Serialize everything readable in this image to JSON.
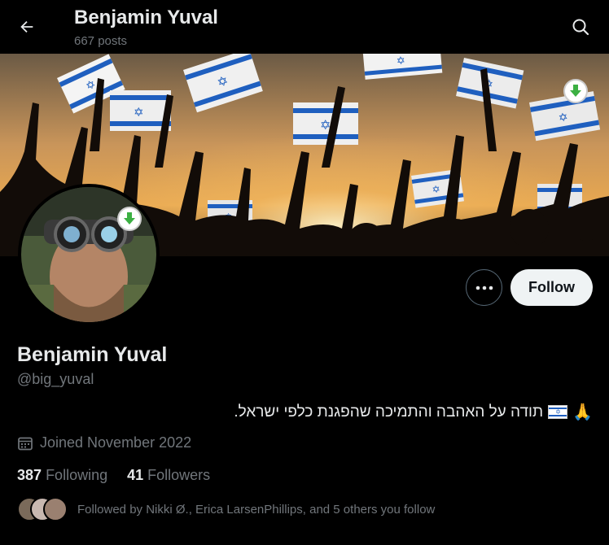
{
  "header": {
    "name": "Benjamin Yuval",
    "posts": "667 posts"
  },
  "icons": {
    "back": "arrow-left-icon",
    "search": "search-icon",
    "download": "download-arrow-icon",
    "more": "more-dots-icon",
    "calendar": "calendar-icon"
  },
  "profile": {
    "display_name": "Benjamin Yuval",
    "handle": "@big_yuval",
    "bio": "תודה על האהבה והתמיכה שהפגנת כלפי ישראל.",
    "joined": "Joined November 2022",
    "following_count": "387",
    "following_label": "Following",
    "followers_count": "41",
    "followers_label": "Followers",
    "followed_by": "Followed by Nikki Ø., Erica LarsenPhillips, and 5 others you follow"
  },
  "actions": {
    "follow_label": "Follow"
  },
  "colors": {
    "background": "#000000",
    "text_primary": "#e7e9ea",
    "text_secondary": "#71767b",
    "follow_button_bg": "#eff3f4",
    "download_green": "#3cb043"
  }
}
